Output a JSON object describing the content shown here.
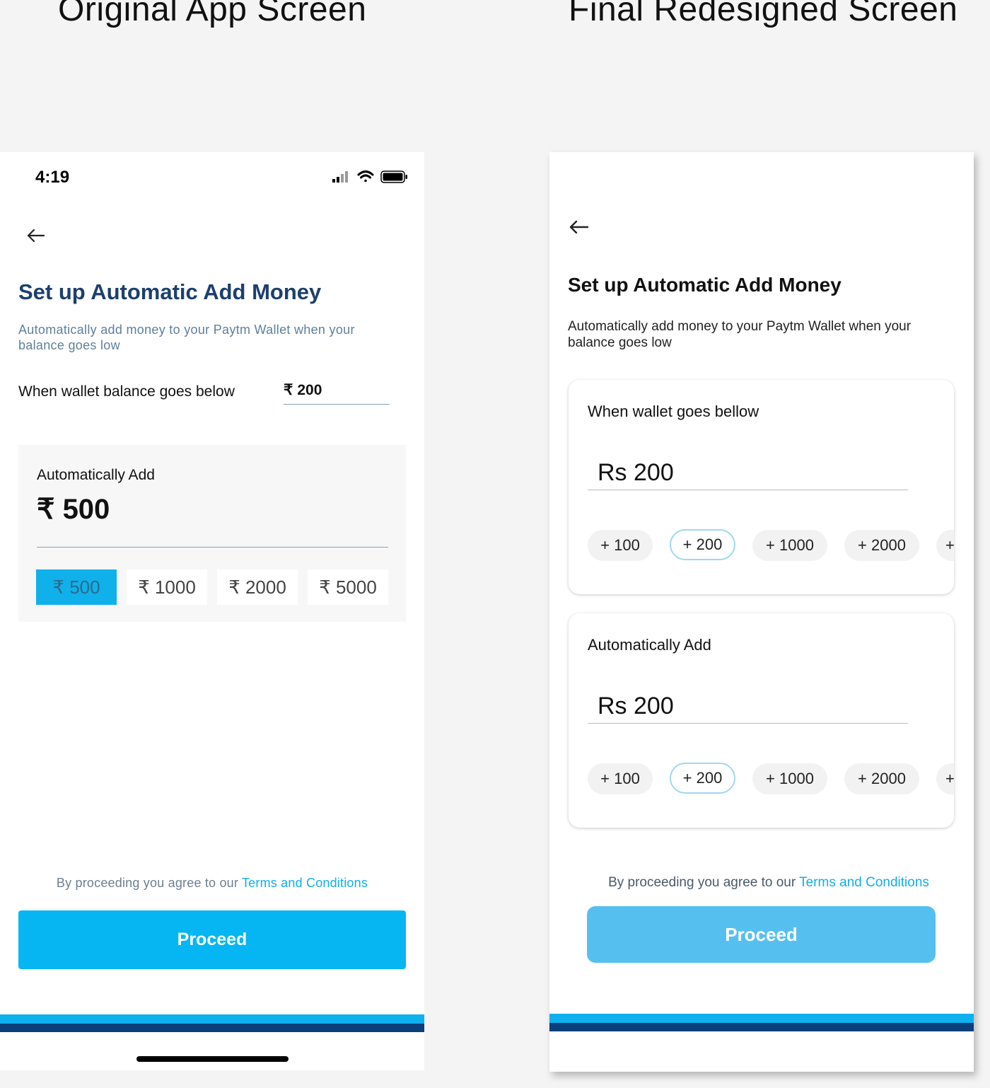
{
  "headings": {
    "original": "Original App Screen",
    "redesigned": "Final Redesigned Screen"
  },
  "original_screen": {
    "status_bar": {
      "time": "4:19",
      "icons": [
        "signal-icon",
        "wifi-icon",
        "battery-icon"
      ]
    },
    "back_icon": "arrow-left-icon",
    "title": "Set up Automatic Add Money",
    "subtitle": "Automatically add money to your Paytm Wallet when your balance goes low",
    "threshold": {
      "label": "When wallet balance goes below",
      "currency": "₹",
      "value": "200"
    },
    "auto_add": {
      "label": "Automatically Add",
      "amount": "₹ 500",
      "options": [
        "₹ 500",
        "₹ 1000",
        "₹ 2000",
        "₹ 5000"
      ],
      "selected_index": 0
    },
    "terms": {
      "prefix": "By proceeding you agree to our ",
      "link": "Terms and Conditions"
    },
    "proceed_label": "Proceed",
    "colors": {
      "title": "#1c3f6e",
      "accent": "#05b6f2",
      "selected_chip": "#10b1ea",
      "stripe_dark": "#0a3f7b"
    }
  },
  "redesigned_screen": {
    "back_icon": "arrow-left-icon",
    "title": "Set up Automatic Add Money",
    "subtitle": "Automatically add money to your Paytm Wallet when your balance goes low",
    "threshold_card": {
      "label": "When wallet goes bellow",
      "amount": "Rs 200",
      "chips": [
        "+ 100",
        "+ 200",
        "+ 1000",
        "+ 2000",
        "+"
      ],
      "selected_index": 1
    },
    "auto_add_card": {
      "label": "Automatically Add",
      "amount": "Rs 200",
      "chips": [
        "+ 100",
        "+ 200",
        "+ 1000",
        "+ 2000",
        "+"
      ],
      "selected_index": 1
    },
    "terms": {
      "prefix": "By proceeding you agree to our ",
      "link": "Terms and Conditions"
    },
    "proceed_label": "Proceed",
    "colors": {
      "accent": "#55c0ef",
      "chip_border": "#9fd8ee",
      "stripe_dark": "#0a3f7b"
    }
  }
}
